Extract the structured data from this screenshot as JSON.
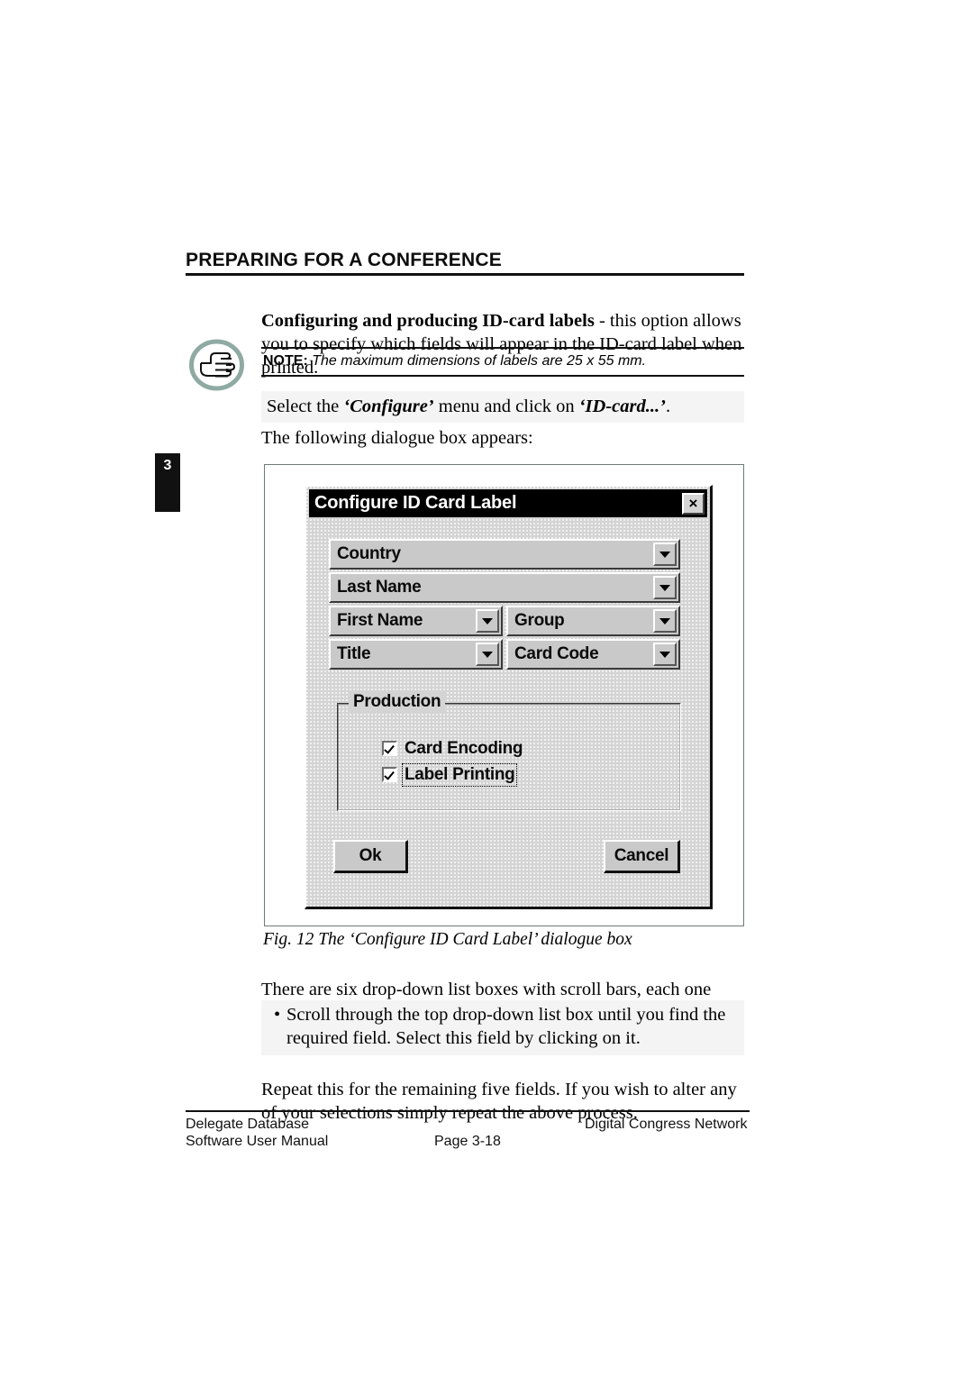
{
  "page": {
    "heading": "PREPARING FOR A CONFERENCE",
    "chapter_tab": "3",
    "intro_bold": "Configuring and producing ID-card labels",
    "intro_rest": " - this option allows you to specify which fields will appear in the ID-card label when printed.",
    "note_label": "NOTE:",
    "note_text": " The maximum dimensions of labels are 25 x 55 mm.",
    "instruction_pre": "Select the ",
    "instruction_menu": "‘Configure’",
    "instruction_mid": " menu and click on ",
    "instruction_item": "‘ID-card...’",
    "instruction_post": ".",
    "following_line": "The following dialogue box appears:",
    "fig_caption": "Fig. 12 The ‘Configure ID Card Label’ dialogue box",
    "body_1": "There are six drop-down list boxes with scroll bars, each one containing a list of all possible fields. To specify the first field:",
    "bullet_dot": "•",
    "bullet_1": "Scroll through the top drop-down list box until you find the required field. Select this field by clicking on it.",
    "body_2": "Repeat this for the remaining five fields. If you wish to alter any of your selections simply repeat the above process.",
    "note_icon_name": "pointing-hand-icon",
    "note_icon_ring_color": "#8fa9a3"
  },
  "dialog": {
    "title": "Configure ID Card Label",
    "close_label": "×",
    "fields": [
      {
        "label": "Country",
        "row": "full"
      },
      {
        "label": "Last Name",
        "row": "full"
      },
      {
        "label": "First Name",
        "row": "half"
      },
      {
        "label": "Group",
        "row": "half"
      },
      {
        "label": "Title",
        "row": "half"
      },
      {
        "label": "Card Code",
        "row": "half"
      }
    ],
    "production": {
      "legend": "Production",
      "checkboxes": [
        {
          "label": "Card Encoding",
          "checked": true,
          "focused": false
        },
        {
          "label": "Label Printing",
          "checked": true,
          "focused": true
        }
      ]
    },
    "buttons": {
      "ok": "Ok",
      "cancel": "Cancel"
    }
  },
  "footer": {
    "left_line1": "Delegate Database",
    "left_line2": "Software User Manual",
    "center": "Page 3-18",
    "right": "Digital Congress Network"
  }
}
